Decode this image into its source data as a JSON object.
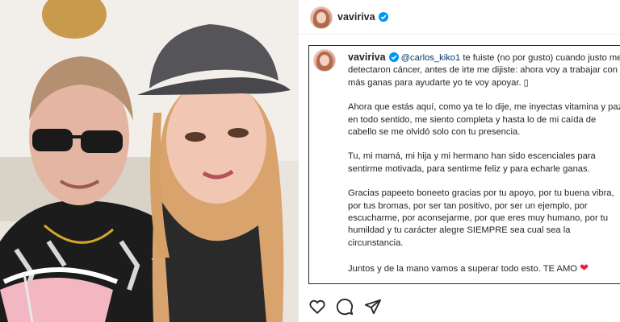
{
  "post": {
    "username": "vaviriva",
    "verified": true
  },
  "caption": {
    "username": "vaviriva",
    "mention": "@carlos_kiko1",
    "p1": " te fuiste (no por gusto) cuando justo me detectaron cáncer, antes de irte me dijiste: ahora voy a trabajar con más ganas para ayudarte yo te voy apoyar. ▯",
    "p2": "Ahora que estás aquí, como ya te lo dije, me inyectas vitamina y paz en todo sentido, me siento completa y hasta lo de mi caída de cabello se me olvidó solo con tu presencia.",
    "p3": "Tu, mi mamá, mi hija y mi hermano han sido escenciales para sentirme motivada, para sentirme feliz y para echarle ganas.",
    "p4": "Gracias papeeto boneeto gracias por tu apoyo, por tu buena vibra, por tus bromas, por ser tan positivo, por ser un ejemplo, por escucharme, por aconsejarme, por que eres muy humano, por tu humildad y tu carácter alegre SIEMPRE sea cual sea la circunstancia.",
    "p5": "Juntos y de la mano vamos a superar todo esto. TE AMO",
    "heart": "❤"
  },
  "actions": {
    "icons": [
      "heart-outline-icon",
      "comment-icon",
      "share-icon"
    ]
  },
  "colors": {
    "mention": "#00376b",
    "verified": "#0095f6",
    "heart": "#ed1c42",
    "text": "#262626"
  }
}
